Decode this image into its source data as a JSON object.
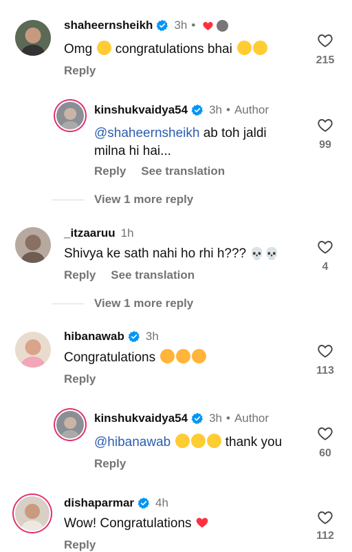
{
  "comments": [
    {
      "username": "shaheernsheikh",
      "time": "3h",
      "text_parts": [
        "Omg",
        "congratulations bhai"
      ],
      "reply": "Reply",
      "likes": "215"
    },
    {
      "username": "kinshukvaidya54",
      "time": "3h",
      "author": "Author",
      "mention": "@shaheernsheikh",
      "text": "ab toh jaldi milna hi hai...",
      "reply": "Reply",
      "translate": "See translation",
      "likes": "99",
      "view_more": "View 1 more reply"
    },
    {
      "username": "_itzaaruu",
      "time": "1h",
      "text": "Shivya ke sath nahi ho rhi h???",
      "reply": "Reply",
      "translate": "See translation",
      "likes": "4",
      "view_more": "View 1 more reply"
    },
    {
      "username": "hibanawab",
      "time": "3h",
      "text": "Congratulations",
      "reply": "Reply",
      "likes": "113"
    },
    {
      "username": "kinshukvaidya54",
      "time": "3h",
      "author": "Author",
      "mention": "@hibanawab",
      "text": "thank you",
      "reply": "Reply",
      "likes": "60"
    },
    {
      "username": "dishaparmar",
      "time": "4h",
      "text": "Wow! Congratulations",
      "reply": "Reply",
      "likes": "112"
    }
  ],
  "icons": [
    "verified-badge-icon",
    "heart-icon",
    "red-heart-icon",
    "hug-emoji",
    "star-eyes-emoji",
    "skull-emoji",
    "heart-eyes-cat-emoji"
  ],
  "colors": {
    "accent_blue": "#0095f6",
    "mention": "#2a5db0",
    "muted": "#737373",
    "like_red": "#ff3040",
    "story_ring": "#e1306c"
  }
}
